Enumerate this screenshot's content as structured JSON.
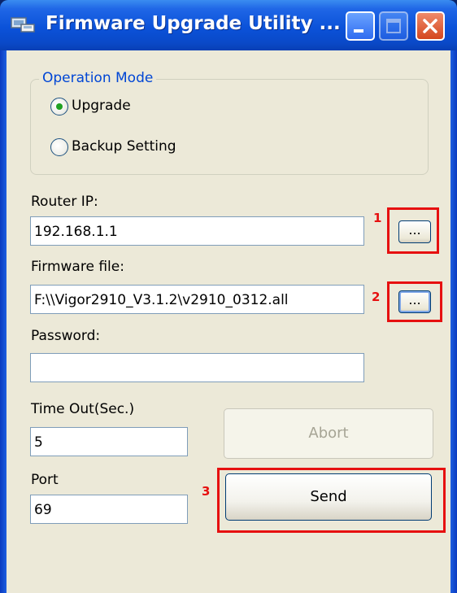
{
  "window": {
    "title": "Firmware Upgrade Utility ..."
  },
  "operation_mode": {
    "legend": "Operation Mode",
    "options": [
      {
        "label": "Upgrade",
        "selected": true
      },
      {
        "label": "Backup Setting",
        "selected": false
      }
    ]
  },
  "router_ip": {
    "label": "Router IP:",
    "value": "192.168.1.1",
    "browse_label": "...",
    "marker": "1"
  },
  "firmware_file": {
    "label": "Firmware file:",
    "value": "F:\\\\Vigor2910_V3.1.2\\v2910_0312.all",
    "browse_label": "...",
    "marker": "2"
  },
  "password": {
    "label": "Password:",
    "value": ""
  },
  "timeout": {
    "label": "Time Out(Sec.)",
    "value": "5"
  },
  "port": {
    "label": "Port",
    "value": "69"
  },
  "buttons": {
    "abort": "Abort",
    "send": "Send",
    "send_marker": "3"
  },
  "colors": {
    "accent_legend": "#0046d5",
    "highlight_red": "#e61010",
    "titlebar_blue": "#0b52d9"
  }
}
